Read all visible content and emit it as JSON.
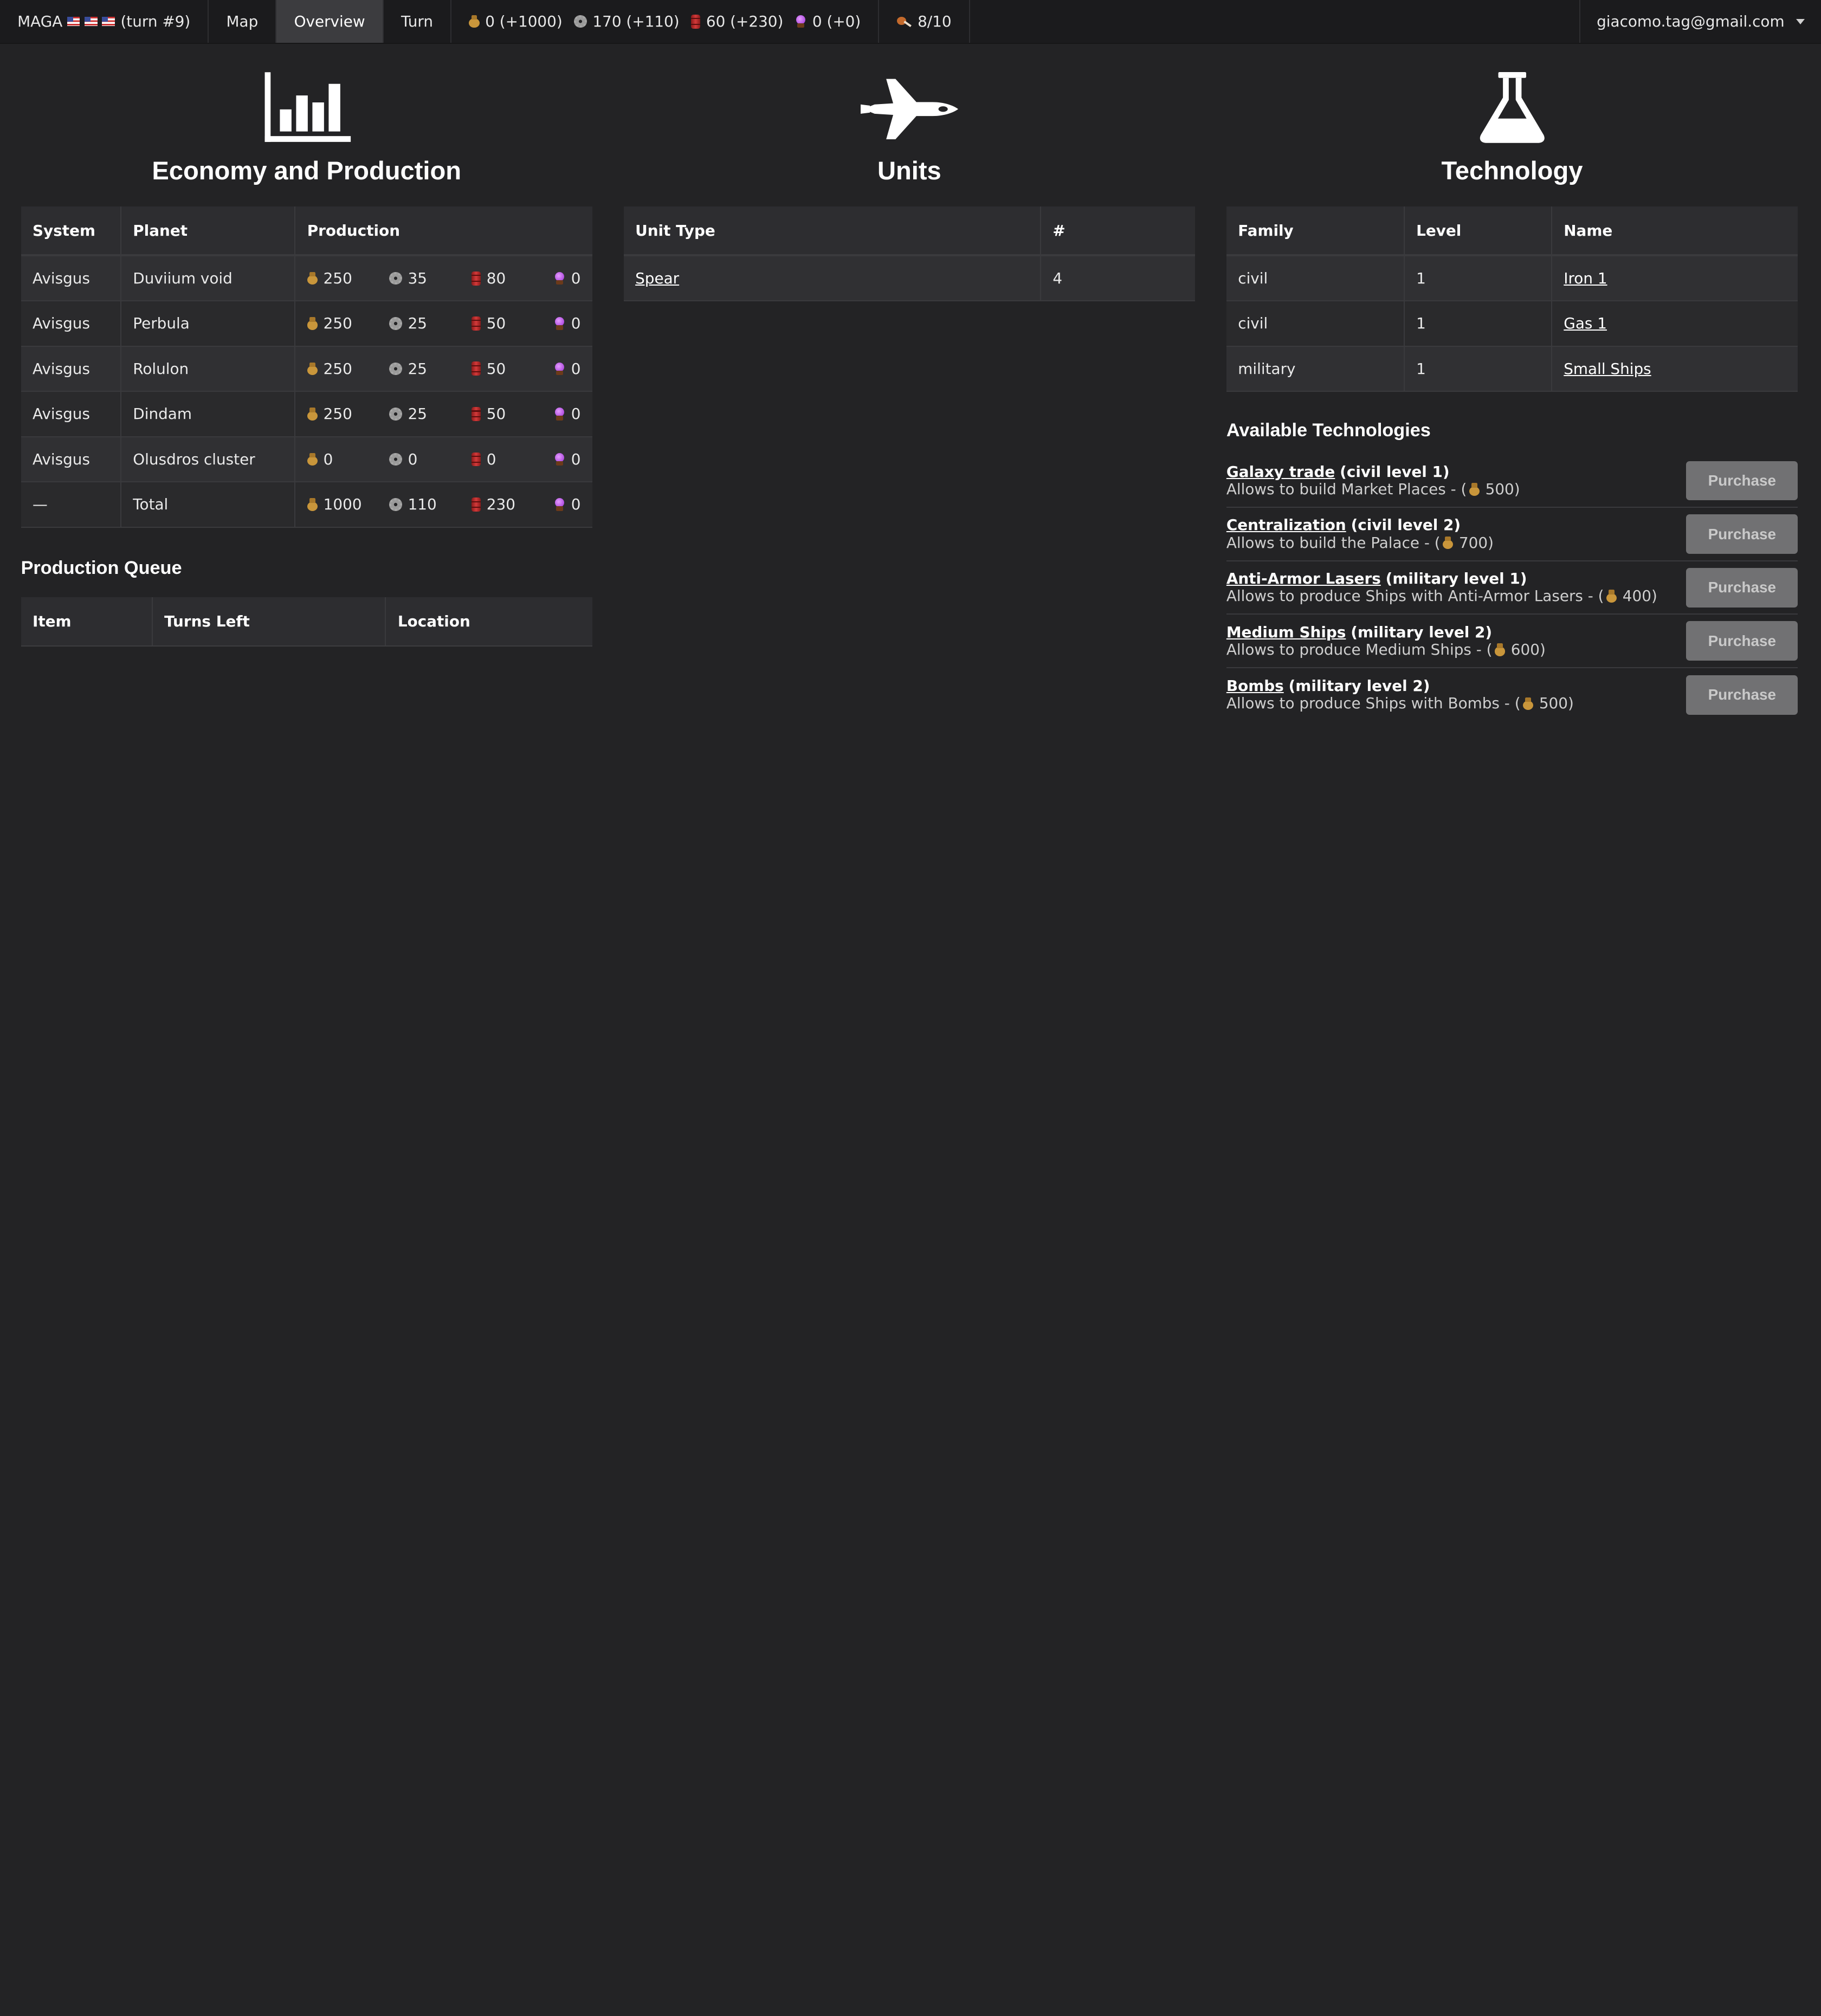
{
  "nav": {
    "brand": "MAGA",
    "turn_label": "(turn #9)",
    "links": [
      "Map",
      "Overview",
      "Turn"
    ],
    "active_link": "Overview",
    "resources": {
      "money": "0 (+1000)",
      "industry": "170 (+110)",
      "oil": "60 (+230)",
      "crystal": "0 (+0)"
    },
    "food": "8/10",
    "user_email": "giacomo.tag@gmail.com"
  },
  "economy": {
    "title": "Economy and Production",
    "headers": [
      "System",
      "Planet",
      "Production"
    ],
    "rows": [
      {
        "system": "Avisgus",
        "planet": "Duviium void",
        "money": "250",
        "industry": "35",
        "oil": "80",
        "crystal": "0"
      },
      {
        "system": "Avisgus",
        "planet": "Perbula",
        "money": "250",
        "industry": "25",
        "oil": "50",
        "crystal": "0"
      },
      {
        "system": "Avisgus",
        "planet": "Rolulon",
        "money": "250",
        "industry": "25",
        "oil": "50",
        "crystal": "0"
      },
      {
        "system": "Avisgus",
        "planet": "Dindam",
        "money": "250",
        "industry": "25",
        "oil": "50",
        "crystal": "0"
      },
      {
        "system": "Avisgus",
        "planet": "Olusdros cluster",
        "money": "0",
        "industry": "0",
        "oil": "0",
        "crystal": "0"
      },
      {
        "system": "—",
        "planet": "Total",
        "money": "1000",
        "industry": "110",
        "oil": "230",
        "crystal": "0"
      }
    ]
  },
  "production_queue": {
    "title": "Production Queue",
    "headers": [
      "Item",
      "Turns Left",
      "Location"
    ]
  },
  "units": {
    "title": "Units",
    "headers": [
      "Unit Type",
      "#"
    ],
    "rows": [
      {
        "type": "Spear",
        "count": "4"
      }
    ]
  },
  "technology": {
    "title": "Technology",
    "headers": [
      "Family",
      "Level",
      "Name"
    ],
    "rows": [
      {
        "family": "civil",
        "level": "1",
        "name": "Iron 1"
      },
      {
        "family": "civil",
        "level": "1",
        "name": "Gas 1"
      },
      {
        "family": "military",
        "level": "1",
        "name": "Small Ships"
      }
    ]
  },
  "available_tech": {
    "title": "Available Technologies",
    "purchase_label": "Purchase",
    "items": [
      {
        "name": "Galaxy trade",
        "level": "(civil level 1)",
        "desc": "Allows to build Market Places - (",
        "cost": "500)"
      },
      {
        "name": "Centralization",
        "level": "(civil level 2)",
        "desc": "Allows to build the Palace - (",
        "cost": "700)"
      },
      {
        "name": "Anti-Armor Lasers",
        "level": "(military level 1)",
        "desc": "Allows to produce Ships with Anti-Armor Lasers - (",
        "cost": "400)"
      },
      {
        "name": "Medium Ships",
        "level": "(military level 2)",
        "desc": "Allows to produce Medium Ships - (",
        "cost": "600)"
      },
      {
        "name": "Bombs",
        "level": "(military level 2)",
        "desc": "Allows to produce Ships with Bombs - (",
        "cost": "500)"
      }
    ]
  },
  "colors": {
    "background": "#232325",
    "navbar": "#1b1b1d",
    "table_row_odd": "#303033",
    "table_row_even": "#2a2a2c",
    "button": "#717173"
  }
}
